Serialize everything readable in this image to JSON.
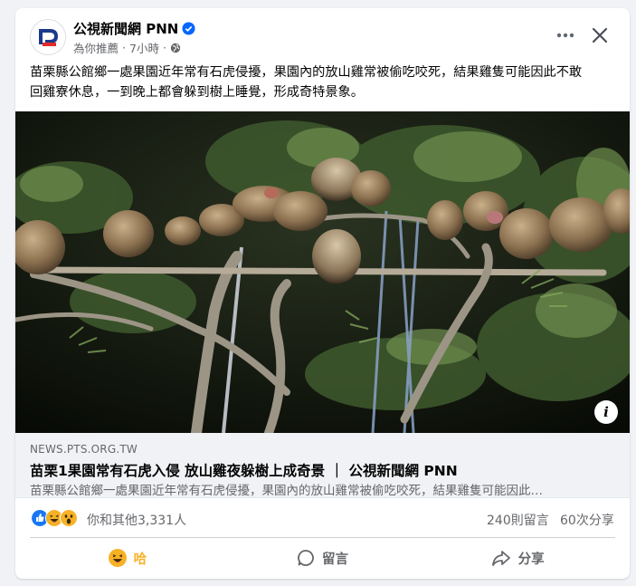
{
  "post": {
    "page_name": "公視新聞網 PNN",
    "meta_recommend": "為你推薦",
    "meta_dot": "·",
    "meta_time": "7小時",
    "meta_dot2": "·",
    "text": "苗栗縣公館鄉一處果園近年常有石虎侵擾，果園內的放山雞常被偷吃咬死，結果雞隻可能因此不敢\n回雞寮休息，一到晚上都會躲到樹上睡覺，形成奇特景象。"
  },
  "link": {
    "domain": "NEWS.PTS.ORG.TW",
    "title": "苗栗1果園常有石虎入侵 放山雞夜躲樹上成奇景 ｜ 公視新聞網 PNN",
    "description": "苗栗縣公館鄉一處果園近年常有石虎侵擾，果園內的放山雞常被偷吃咬死，結果雞隻可能因此…"
  },
  "engagement": {
    "reactions_text": "你和其他3,331人",
    "comments_text": "240則留言",
    "shares_text": "60次分享"
  },
  "actions": {
    "like_label": "哈",
    "comment_label": "留言",
    "share_label": "分享"
  },
  "icons": {
    "more": "more-dots-icon",
    "close": "close-icon",
    "verified": "verified-badge-icon",
    "globe": "globe-icon",
    "info": "info-icon"
  },
  "colors": {
    "link_title": "#050505",
    "secondary_text": "#65676b",
    "verified_blue": "#0866ff",
    "haha_yellow": "#f7b125",
    "like_blue": "#1877f2"
  },
  "media": {
    "info_symbol": "i"
  }
}
